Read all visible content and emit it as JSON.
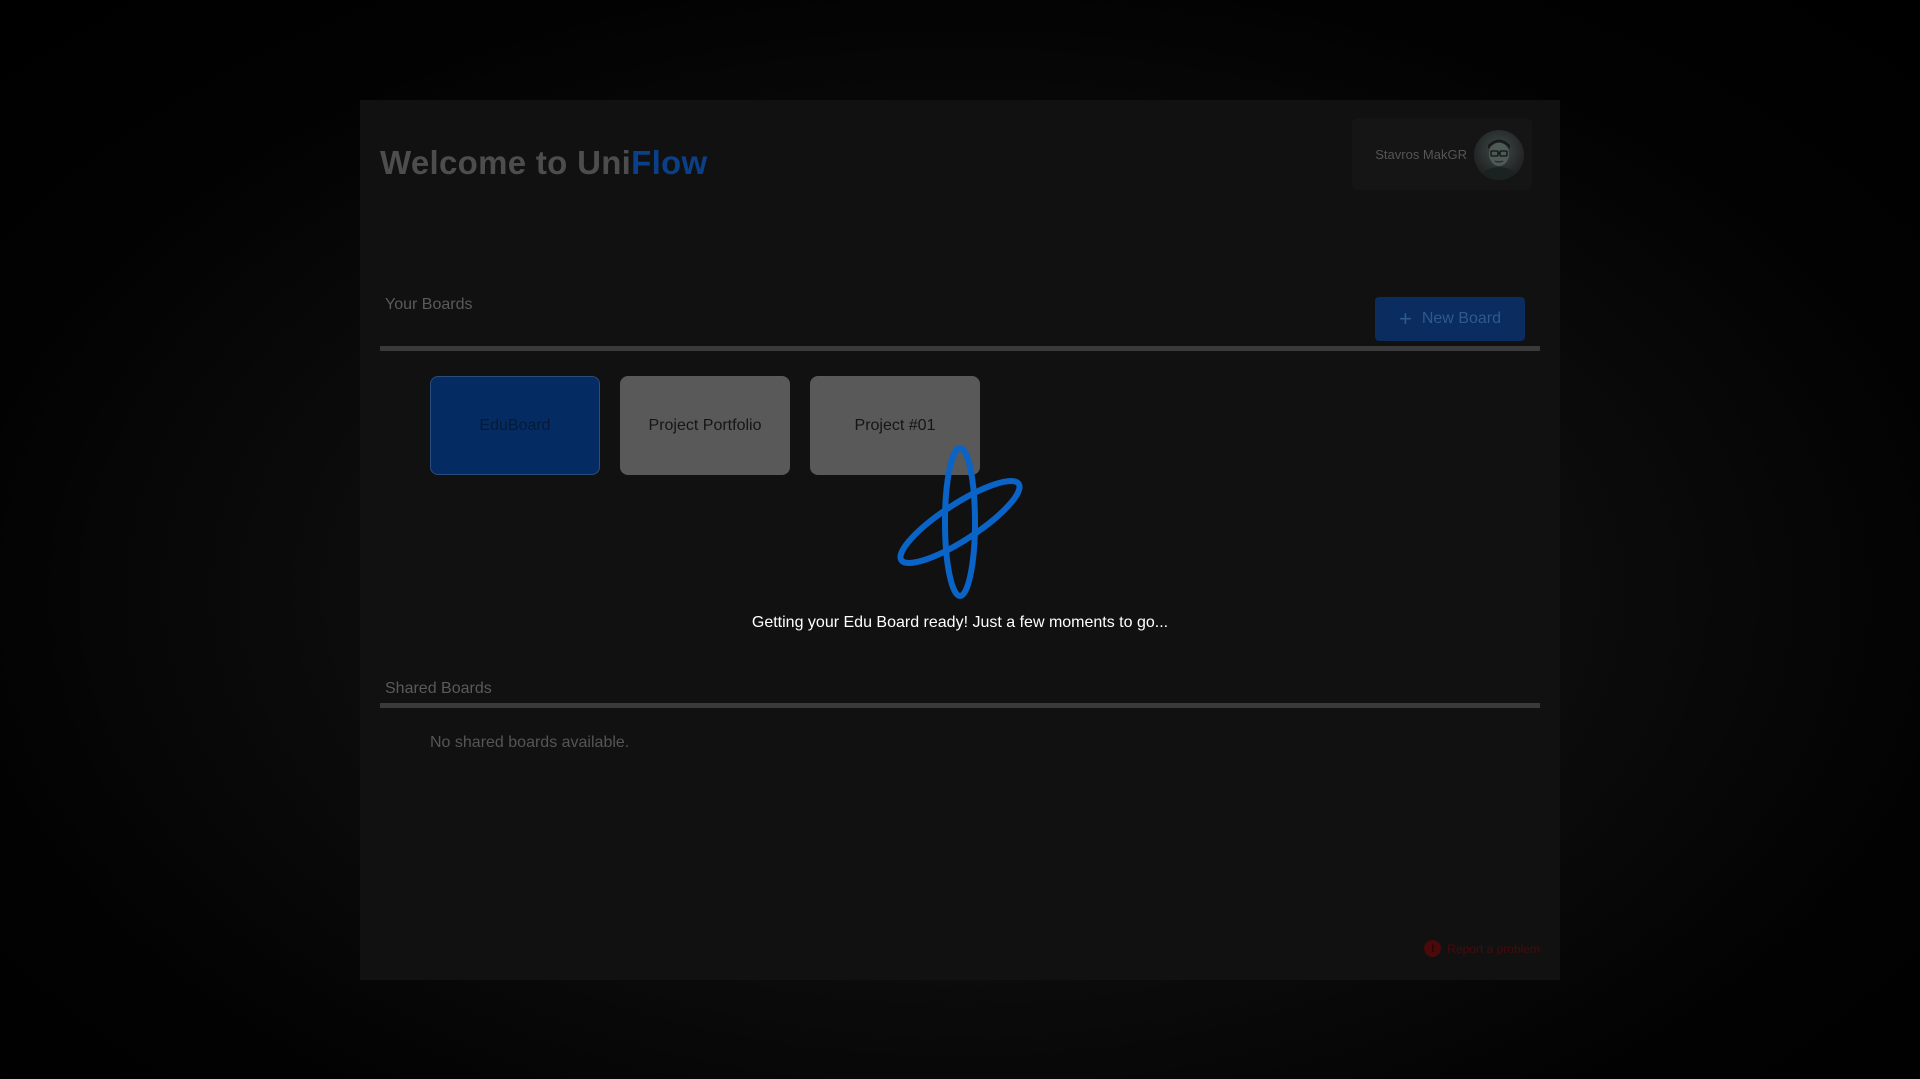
{
  "header": {
    "title_prefix": "Welcome to ",
    "brand_part1": "Uni",
    "brand_part2": "Flow",
    "user_name": "Stavros MakGR"
  },
  "your_boards": {
    "label": "Your Boards",
    "new_board_label": "New Board",
    "boards": [
      {
        "name": "EduBoard",
        "selected": true
      },
      {
        "name": "Project Portfolio",
        "selected": false
      },
      {
        "name": "Project #01",
        "selected": false
      }
    ]
  },
  "shared_boards": {
    "label": "Shared Boards",
    "empty_message": "No shared boards available."
  },
  "footer": {
    "report_label": "Report a problem",
    "report_icon_glyph": "!"
  },
  "loading": {
    "message": "Getting your Edu Board ready! Just a few moments to go...",
    "icon": "orbit-spinner-icon"
  },
  "colors": {
    "brand_blue": "#0a3f8a",
    "loader_blue": "#0a64c8",
    "report_red": "#4a0a0a"
  }
}
